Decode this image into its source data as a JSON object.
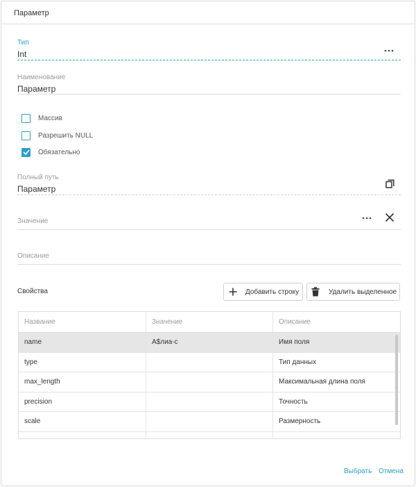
{
  "dialog": {
    "title": "Параметр"
  },
  "type_field": {
    "label": "Тип",
    "value": "Int"
  },
  "name_field": {
    "label": "Наименование",
    "value": "Параметр"
  },
  "checkboxes": [
    {
      "label": "Массив",
      "checked": false
    },
    {
      "label": "Разрешить NULL",
      "checked": false
    },
    {
      "label": "Обязательно",
      "checked": true
    }
  ],
  "path_field": {
    "label": "Полный путь",
    "value": "Параметр"
  },
  "value_field": {
    "label": "Значение"
  },
  "description_field": {
    "label": "Описание"
  },
  "properties": {
    "label": "Свойства",
    "add_label": "Добавить строку",
    "delete_label": "Удалить выделенное",
    "columns": [
      "Название",
      "Значение",
      "Описание"
    ],
    "rows": [
      [
        "name",
        "A$лиа-с",
        "Имя поля"
      ],
      [
        "type",
        "",
        "Тип данных"
      ],
      [
        "max_length",
        "",
        "Максимальная длина поля"
      ],
      [
        "precision",
        "",
        "Точность"
      ],
      [
        "scale",
        "",
        "Размерность"
      ]
    ]
  },
  "footer": {
    "select_label": "Выбрать",
    "cancel_label": "Отмена"
  },
  "colors": {
    "accent": "#2b9fcb",
    "selected_row": "#e6e6e6"
  }
}
